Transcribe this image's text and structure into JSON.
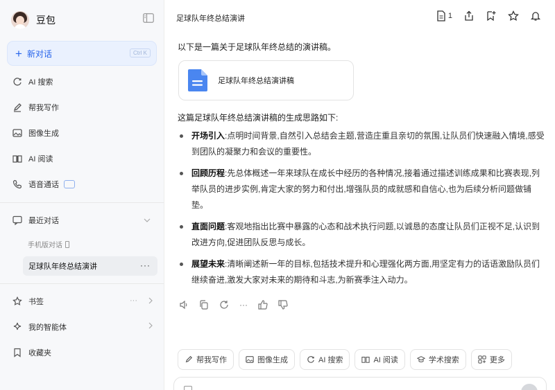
{
  "sidebar": {
    "app_name": "豆包",
    "new_chat": {
      "label": "新对话",
      "shortcut": "Ctrl K"
    },
    "nav": [
      {
        "label": "AI 搜索",
        "icon": "search-refresh-icon"
      },
      {
        "label": "帮我写作",
        "icon": "pen-icon"
      },
      {
        "label": "图像生成",
        "icon": "image-icon"
      },
      {
        "label": "AI 阅读",
        "icon": "book-icon"
      },
      {
        "label": "语音通话",
        "icon": "phone-icon"
      }
    ],
    "recent": {
      "label": "最近对话",
      "sub_label": "手机版对话",
      "active_item": "足球队年终总结演讲",
      "more": "···"
    },
    "bottom": [
      {
        "label": "书签",
        "icon": "star-icon"
      },
      {
        "label": "我的智能体",
        "icon": "sparkle-icon"
      },
      {
        "label": "收藏夹",
        "icon": "bookmark-icon"
      }
    ],
    "more_dots": "···"
  },
  "header": {
    "title": "足球队年终总结演讲",
    "doc_count": "1"
  },
  "message": {
    "intro": "以下是一篇关于足球队年终总结的演讲稿。",
    "doc_card_title": "足球队年终总结演讲稿",
    "lead": "这篇足球队年终总结演讲稿的生成思路如下:",
    "points": [
      {
        "head": "开场引入",
        "sep": ":",
        "text": "点明时间背景,自然引入总结会主题,营造庄重且亲切的氛围,让队员们快速融入情境,感受到团队的凝聚力和会议的重要性。"
      },
      {
        "head": "回顾历程",
        "sep": ":",
        "text": "先总体概述一年来球队在成长中经历的各种情况,接着通过描述训练成果和比赛表现,列举队员的进步实例,肯定大家的努力和付出,增强队员的成就感和自信心,也为后续分析问题做铺垫。"
      },
      {
        "head": "直面问题",
        "sep": ":",
        "text": "客观地指出比赛中暴露的心态和战术执行问题,以诚恳的态度让队员们正视不足,认识到改进方向,促进团队反思与成长。"
      },
      {
        "head": "展望未来",
        "sep": ":",
        "text": "清晰阐述新一年的目标,包括技术提升和心理强化两方面,用坚定有力的话语激励队员们继续奋进,激发大家对未来的期待和斗志,为新赛季注入动力。"
      }
    ],
    "actions_more": "···"
  },
  "suggestions": [
    {
      "label": "帮我写作",
      "icon": "pen-icon"
    },
    {
      "label": "图像生成",
      "icon": "image-icon"
    },
    {
      "label": "AI 搜索",
      "icon": "search-refresh-icon"
    },
    {
      "label": "AI 阅读",
      "icon": "book-icon"
    },
    {
      "label": "学术搜索",
      "icon": "academic-icon"
    },
    {
      "label": "更多",
      "icon": "grid-icon"
    }
  ],
  "colors": {
    "accent": "#2563eb",
    "sidebar_bg": "#f7f8fa",
    "doc_icon": "#4a86f0"
  }
}
